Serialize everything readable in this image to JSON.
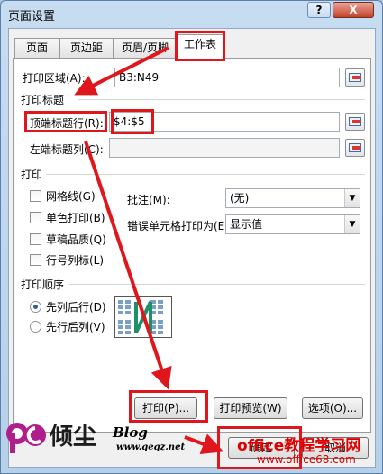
{
  "window": {
    "title": "页面设置",
    "help_label": "?",
    "close_label": "X"
  },
  "tabs": [
    {
      "label": "页面",
      "active": false
    },
    {
      "label": "页边距",
      "active": false
    },
    {
      "label": "页眉/页脚",
      "active": false
    },
    {
      "label": "工作表",
      "active": true
    }
  ],
  "print_area": {
    "label": "打印区域(A):",
    "value": "B3:N49"
  },
  "print_titles": {
    "section": "打印标题",
    "rows_label": "顶端标题行(R):",
    "rows_value": "$4:$5",
    "cols_label": "左端标题列(C):",
    "cols_value": ""
  },
  "print": {
    "section": "打印",
    "checkboxes": [
      {
        "label": "网格线(G)",
        "checked": false
      },
      {
        "label": "单色打印(B)",
        "checked": false
      },
      {
        "label": "草稿品质(Q)",
        "checked": false
      },
      {
        "label": "行号列标(L)",
        "checked": false
      }
    ],
    "comments_label": "批注(M):",
    "comments_value": "(无)",
    "errors_label": "错误单元格打印为(E):",
    "errors_value": "显示值"
  },
  "print_order": {
    "section": "打印顺序",
    "options": [
      {
        "label": "先列后行(D)",
        "selected": true
      },
      {
        "label": "先行后列(V)",
        "selected": false
      }
    ]
  },
  "buttons": {
    "print": "打印(P)...",
    "preview": "打印预览(W)",
    "options": "选项(O)...",
    "ok": "确定",
    "cancel": "取消"
  },
  "watermark": {
    "logo_letters": "qc",
    "brand": "倾尘",
    "blog": "Blog",
    "blog_url": "www.qeqz.net",
    "site_name": "office教程学习网",
    "site_url": "www.office68.com"
  },
  "colors": {
    "annotation_red": "#e0161d",
    "window_blue": "#b6d0ea",
    "arrow_red": "#e0161d"
  }
}
